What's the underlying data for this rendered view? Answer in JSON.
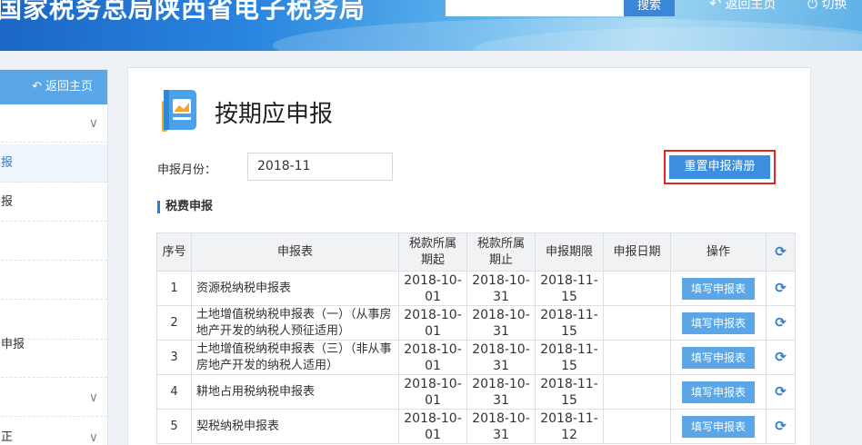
{
  "header": {
    "site_title": "国家税务总局陕西省电子税务局",
    "search_button": "搜索",
    "home_link": "返回主页",
    "switch_link": "切换"
  },
  "sidebar": {
    "back_button": "返回主页",
    "items": [
      {
        "label": ""
      },
      {
        "label": "报"
      },
      {
        "label": "报"
      },
      {
        "label": ""
      },
      {
        "label": ""
      },
      {
        "label": "申报"
      },
      {
        "label": ""
      },
      {
        "label": "正"
      }
    ]
  },
  "main": {
    "page_title": "按期应申报",
    "month_label": "申报月份：",
    "month_value": "2018-11",
    "clear_button": "重置申报清册",
    "section_title": "税费申报",
    "columns": [
      "序号",
      "申报表",
      "税款所属期起",
      "税款所属期止",
      "申报期限",
      "申报日期",
      "操作"
    ],
    "col_start": [
      "税款所属",
      "期起"
    ],
    "col_end": [
      "税款所属",
      "期止"
    ],
    "rows": [
      {
        "no": "1",
        "name": "资源税纳税申报表",
        "start": [
          "2018-10-",
          "01"
        ],
        "end": [
          "2018-10-",
          "31"
        ],
        "deadline": [
          "2018-11-",
          "15"
        ],
        "date": "",
        "action": "填写申报表"
      },
      {
        "no": "2",
        "name": "土地增值税纳税申报表（一）（从事房地产开发的纳税人预征适用）",
        "start": [
          "2018-10-",
          "01"
        ],
        "end": [
          "2018-10-",
          "31"
        ],
        "deadline": [
          "2018-11-",
          "15"
        ],
        "date": "",
        "action": "填写申报表"
      },
      {
        "no": "3",
        "name": "土地增值税纳税申报表（三）（非从事房地产开发的纳税人适用）",
        "start": [
          "2018-10-",
          "01"
        ],
        "end": [
          "2018-10-",
          "31"
        ],
        "deadline": [
          "2018-11-",
          "15"
        ],
        "date": "",
        "action": "填写申报表"
      },
      {
        "no": "4",
        "name": "耕地占用税纳税申报表",
        "start": [
          "2018-10-",
          "01"
        ],
        "end": [
          "2018-10-",
          "31"
        ],
        "deadline": [
          "2018-11-",
          "15"
        ],
        "date": "",
        "action": "填写申报表"
      },
      {
        "no": "5",
        "name": "契税纳税申报表",
        "start": [
          "2018-10-",
          "01"
        ],
        "end": [
          "2018-10-",
          "31"
        ],
        "deadline": [
          "2018-11-",
          "12"
        ],
        "date": "",
        "action": "填写申报表"
      }
    ]
  },
  "colors": {
    "accent": "#2a7dd6",
    "button": "#5aa6e6",
    "highlight_border": "#e0261f"
  }
}
